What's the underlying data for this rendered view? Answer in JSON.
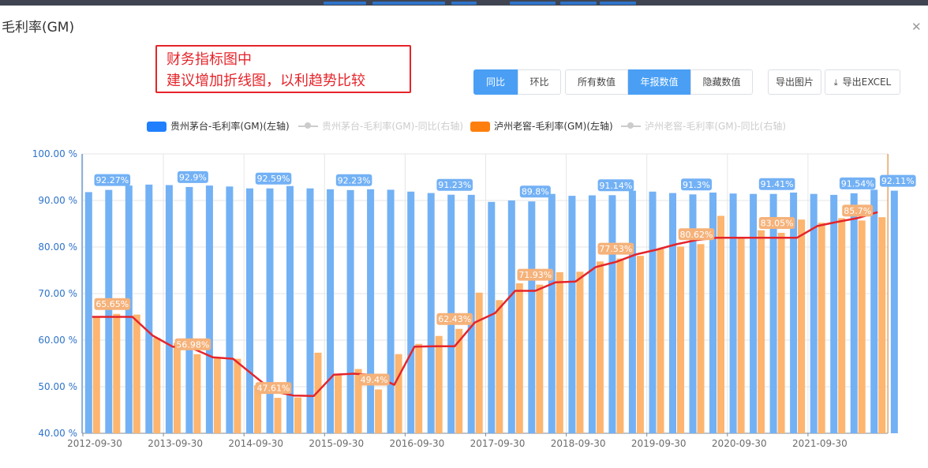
{
  "window": {
    "title": "毛利率(GM)"
  },
  "annotation": {
    "lines": [
      "财务指标图中",
      "建议增加折线图，以利趋势比较"
    ]
  },
  "toolbar": {
    "compare_group": [
      {
        "label": "同比",
        "active": true
      },
      {
        "label": "环比",
        "active": false
      }
    ],
    "value_group": [
      {
        "label": "所有数值",
        "active": false
      },
      {
        "label": "年报数值",
        "active": true
      },
      {
        "label": "隐藏数值",
        "active": false
      }
    ],
    "export_image": "导出图片",
    "export_excel": "导出EXCEL"
  },
  "legend": [
    {
      "label": "贵州茅台-毛利率(GM)(左轴)",
      "color": "#1f7fff",
      "kind": "bar",
      "enabled": true
    },
    {
      "label": "贵州茅台-毛利率(GM)-同比(右轴)",
      "color": "#cccccc",
      "kind": "line",
      "enabled": false
    },
    {
      "label": "泸州老窖-毛利率(GM)(左轴)",
      "color": "#ff7f0e",
      "kind": "bar",
      "enabled": true
    },
    {
      "label": "泸州老窖-毛利率(GM)-同比(右轴)",
      "color": "#cccccc",
      "kind": "line",
      "enabled": false
    }
  ],
  "colors": {
    "maotai_bar": "#73b1f5",
    "laojiao_bar": "#fdb56f",
    "maotai_label_bg": "#73b1f5",
    "laojiao_label_bg": "#f5b27a",
    "trend_line": "#e5242a",
    "axis_text": "#2f73c9",
    "grid": "#e6e6e6",
    "marker": "#e8882b"
  },
  "chart_data": {
    "type": "bar",
    "y_axis_ticks": [
      "40.00 %",
      "50.00 %",
      "60.00 %",
      "70.00 %",
      "80.00 %",
      "90.00 %",
      "100.00 %"
    ],
    "ylim": [
      40,
      100
    ],
    "x_tick_labels": [
      "2012-09-30",
      "2013-09-30",
      "2014-09-30",
      "2015-09-30",
      "2016-09-30",
      "2017-09-30",
      "2018-09-30",
      "2019-09-30",
      "2020-09-30",
      "2021-09-30"
    ],
    "categories_count": 40,
    "series": [
      {
        "name": "贵州茅台-毛利率(GM)(左轴)",
        "values": [
          91.8,
          92.27,
          93.2,
          93.4,
          93.3,
          92.9,
          93.2,
          93.0,
          92.6,
          92.59,
          93.1,
          92.6,
          92.4,
          92.23,
          92.4,
          92.3,
          91.9,
          91.6,
          91.23,
          91.2,
          89.7,
          90.0,
          89.8,
          91.4,
          91.0,
          91.1,
          91.14,
          92.1,
          91.9,
          91.6,
          91.3,
          91.7,
          91.5,
          91.4,
          91.41,
          91.7,
          91.4,
          91.2,
          91.54,
          92.3,
          92.11
        ],
        "labels": [
          {
            "index": 1,
            "text": "92.27%"
          },
          {
            "index": 5,
            "text": "92.9%"
          },
          {
            "index": 9,
            "text": "92.59%"
          },
          {
            "index": 13,
            "text": "92.23%"
          },
          {
            "index": 18,
            "text": "91.23%"
          },
          {
            "index": 22,
            "text": "89.8%"
          },
          {
            "index": 26,
            "text": "91.14%"
          },
          {
            "index": 30,
            "text": "91.3%"
          },
          {
            "index": 34,
            "text": "91.41%"
          },
          {
            "index": 38,
            "text": "91.54%"
          },
          {
            "index": 40,
            "text": "92.11%"
          }
        ]
      },
      {
        "name": "泸州老窖-毛利率(GM)(左轴)",
        "values": [
          65.0,
          65.65,
          65.5,
          60.5,
          59.4,
          56.98,
          56.2,
          56.0,
          50.3,
          47.61,
          47.7,
          57.3,
          52.5,
          53.8,
          49.4,
          57.0,
          59.2,
          60.9,
          62.43,
          70.2,
          68.6,
          72.2,
          71.93,
          74.6,
          74.7,
          76.9,
          77.53,
          78.1,
          79.6,
          80.1,
          80.62,
          86.7,
          82.1,
          83.6,
          83.05,
          85.9,
          85.2,
          86.2,
          85.7,
          86.4
        ],
        "labels": [
          {
            "index": 1,
            "text": "65.65%"
          },
          {
            "index": 5,
            "text": "56.98%"
          },
          {
            "index": 9,
            "text": "47.61%"
          },
          {
            "index": 14,
            "text": "49.4%"
          },
          {
            "index": 18,
            "text": "62.43%"
          },
          {
            "index": 22,
            "text": "71.93%"
          },
          {
            "index": 26,
            "text": "77.53%"
          },
          {
            "index": 30,
            "text": "80.62%"
          },
          {
            "index": 34,
            "text": "83.05%"
          },
          {
            "index": 38,
            "text": "85.7%"
          }
        ]
      },
      {
        "name": "",
        "kind": "hand-drawn trend line",
        "values": [
          65.0,
          65.0,
          65.0,
          61.0,
          58.6,
          58.2,
          56.3,
          56.0,
          52.5,
          49.0,
          48.1,
          48.0,
          52.6,
          52.8,
          52.5,
          50.4,
          58.6,
          58.7,
          58.7,
          63.8,
          65.8,
          70.6,
          70.6,
          72.4,
          72.6,
          75.7,
          76.8,
          78.4,
          79.4,
          80.6,
          81.5,
          82.0,
          82.0,
          82.0,
          82.0,
          82.0,
          84.5,
          85.4,
          86.2,
          87.5
        ]
      }
    ],
    "grid": true,
    "legend_position": "top"
  }
}
